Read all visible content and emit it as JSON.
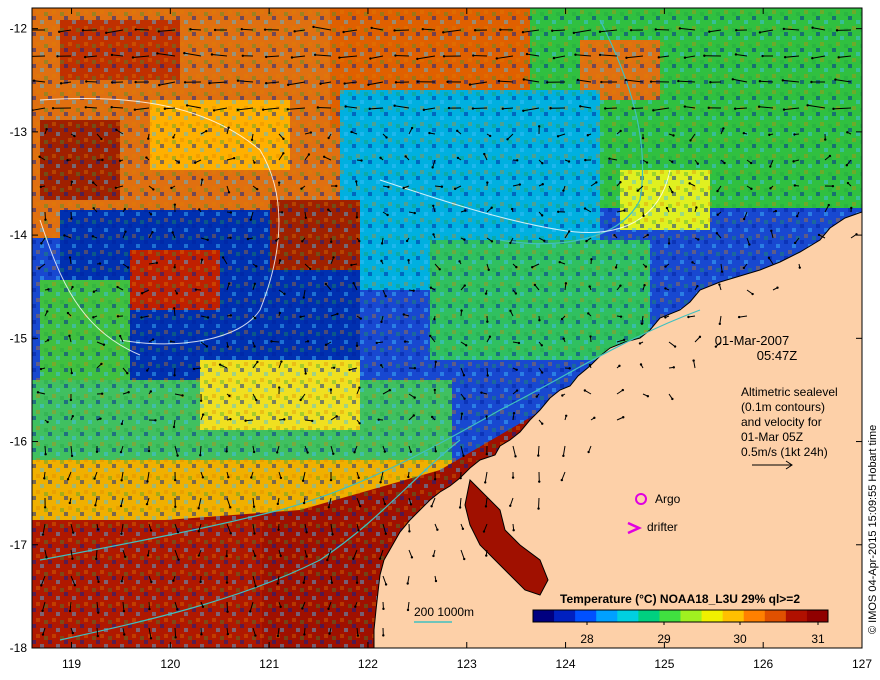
{
  "map": {
    "lon_ticks": [
      "119",
      "120",
      "121",
      "122",
      "123",
      "124",
      "125",
      "126",
      "127"
    ],
    "lat_ticks": [
      "-12",
      "-13",
      "-14",
      "-15",
      "-16",
      "-17",
      "-18"
    ],
    "lon_range": [
      118.6,
      127
    ],
    "lat_range": [
      -18,
      -11.8
    ],
    "land_color": "#fdd0a8",
    "coastline_color": "#000000"
  },
  "annotations": {
    "date": "01-Mar-2007",
    "time": "05:47Z",
    "altimetry_lines": [
      "Altimetric sealevel",
      "(0.1m contours)",
      "and velocity for",
      "01-Mar 05Z",
      "0.5m/s (1kt 24h)"
    ],
    "argo_label": "Argo",
    "drifter_label": "drifter",
    "bathymetry_label": "200  1000m",
    "argo_color": "#e000e0",
    "drifter_color": "#e000e0",
    "bathymetry_color": "#40c0c0"
  },
  "colorbar": {
    "title": "Temperature (°C) NOAA18_L3U 29% ql>=2",
    "ticks": [
      "28",
      "29",
      "30",
      "31"
    ],
    "colors": [
      "#000080",
      "#0020c0",
      "#0050ff",
      "#00a0ff",
      "#00d0e0",
      "#00d080",
      "#40e040",
      "#a0f020",
      "#f0f000",
      "#ffc000",
      "#ff8000",
      "#e05000",
      "#b01000",
      "#900000"
    ]
  },
  "credit": "© IMOS 04-Apr-2015 15:09:55 Hobart time"
}
